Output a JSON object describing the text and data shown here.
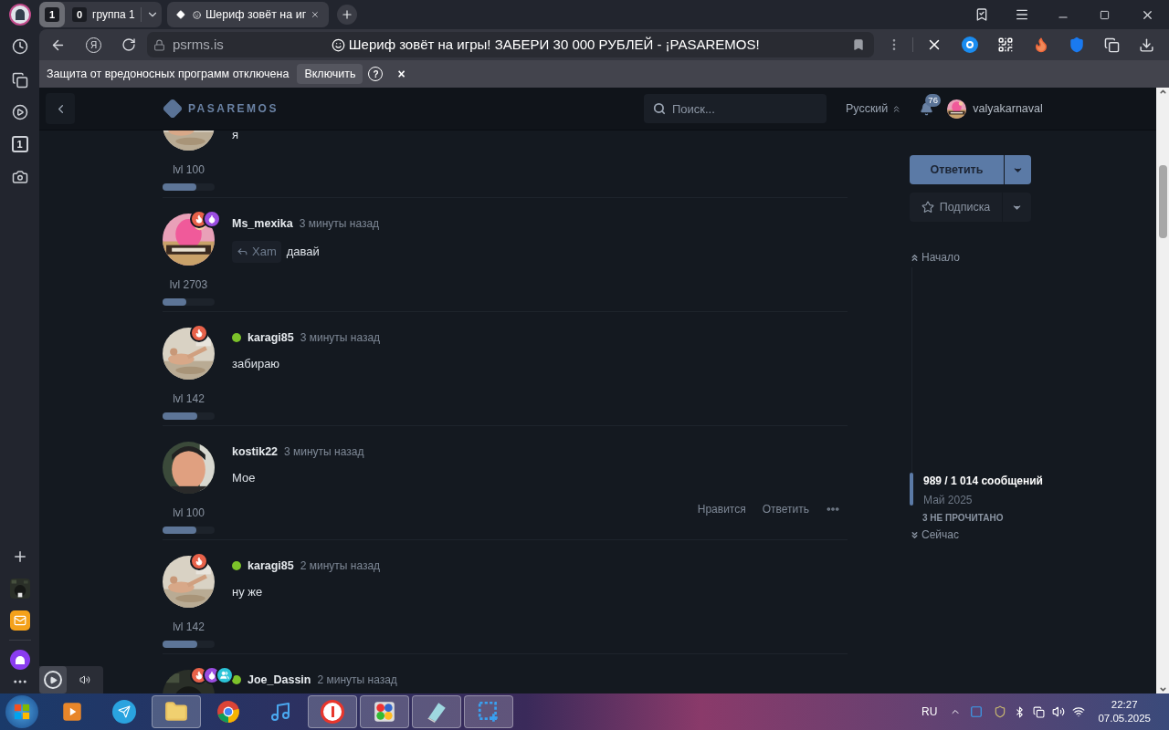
{
  "browser": {
    "tab_group": {
      "count": "1",
      "badge": "0",
      "name": "группа 1"
    },
    "tabs": [
      {
        "title": "Шериф зовёт на иг",
        "selected": true
      }
    ],
    "address": {
      "domain": "psrms.is",
      "title": "Шериф зовёт на игры! ЗАБЕРИ 30 000 РУБЛЕЙ - ¡PASAREMOS!"
    },
    "infobar": {
      "message": "Защита от вредоносных программ отключена",
      "button": "Включить",
      "help": "?",
      "close": "×"
    },
    "sidebar": {
      "counter": "1"
    },
    "home_letter": "Я"
  },
  "site": {
    "logo": "PASAREMOS",
    "search_placeholder": "Поиск...",
    "language": "Русский",
    "notifications": "76",
    "username": "valyakarnaval"
  },
  "posts": [
    {
      "text": "я",
      "level_label": "lvl 100",
      "level": 0.65
    },
    {
      "username": "Ms_mexika",
      "online": false,
      "time": "3 минуты назад",
      "quote": "Xam",
      "text": "давай",
      "level_label": "lvl 2703",
      "level": 0.45,
      "badges": [
        {
          "kind": "fire",
          "color": "#e8624a"
        },
        {
          "kind": "drop",
          "color": "#9b4de0"
        }
      ]
    },
    {
      "username": "karagi85",
      "online": true,
      "time": "3 минуты назад",
      "text": "забираю",
      "level_label": "lvl 142",
      "level": 0.67,
      "badges": [
        {
          "kind": "fire",
          "color": "#e8624a"
        }
      ]
    },
    {
      "username": "kostik22",
      "online": false,
      "time": "3 минуты назад",
      "text": "Мое",
      "level_label": "lvl 100",
      "level": 0.65,
      "actions": [
        "Нравится",
        "Ответить"
      ],
      "more": true
    },
    {
      "username": "karagi85",
      "online": true,
      "time": "2 минуты назад",
      "text": "ну же",
      "level_label": "lvl 142",
      "level": 0.67,
      "badges": [
        {
          "kind": "fire",
          "color": "#e8624a"
        }
      ]
    },
    {
      "username": "Joe_Dassin",
      "online": true,
      "time": "2 минуты назад",
      "badges": [
        {
          "kind": "fire",
          "color": "#e8624a"
        },
        {
          "kind": "drop",
          "color": "#9b4de0"
        },
        {
          "kind": "users",
          "color": "#2bc4d8"
        }
      ]
    }
  ],
  "thread_actions": {
    "reply": "Ответить",
    "subscribe": "Подписка"
  },
  "scroller": {
    "start": "Начало",
    "position": "989 / 1 014 сообщений",
    "date": "Май 2025",
    "unread": "3 НЕ ПРОЧИТАНО",
    "end": "Сейчас"
  },
  "taskbar": {
    "language": "RU",
    "time": "22:27",
    "date": "07.05.2025",
    "apps": [
      {
        "kind": "media",
        "open": false
      },
      {
        "kind": "telegram",
        "open": false
      },
      {
        "kind": "explorer",
        "open": true
      },
      {
        "kind": "chrome",
        "open": false
      },
      {
        "kind": "music",
        "open": false
      },
      {
        "kind": "yandex",
        "open": true
      },
      {
        "kind": "grid",
        "open": true
      },
      {
        "kind": "notebook",
        "open": true
      },
      {
        "kind": "snip",
        "open": true
      }
    ]
  }
}
